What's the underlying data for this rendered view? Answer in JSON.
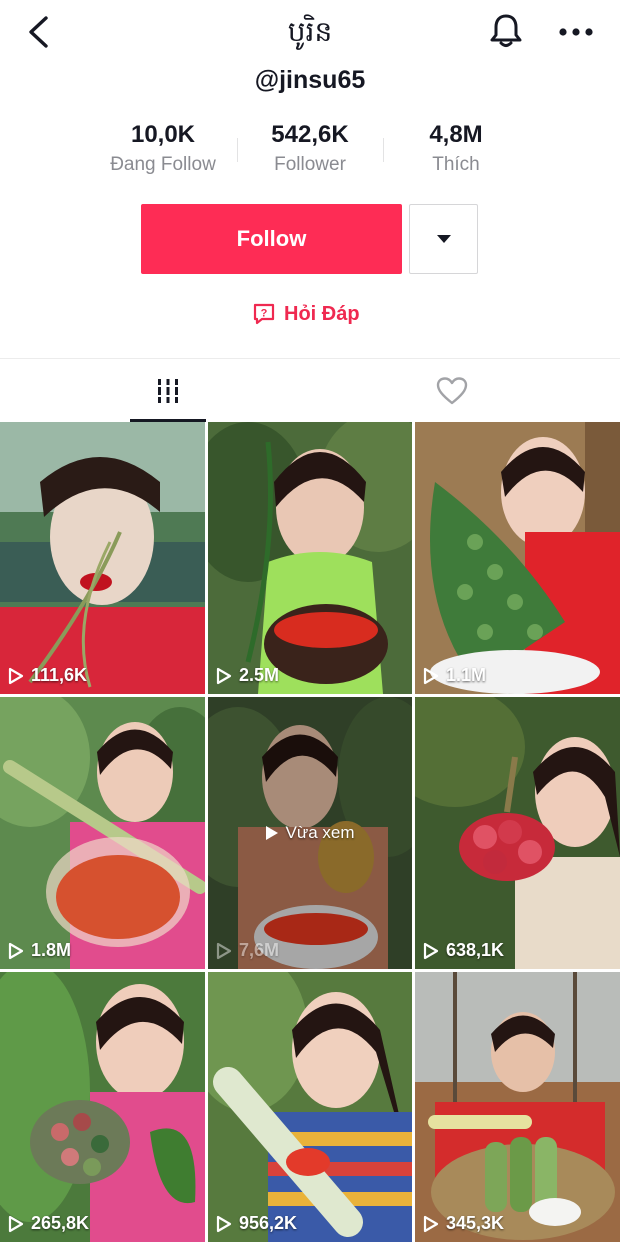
{
  "header": {
    "title": "បូរិន",
    "handle": "@jinsu65"
  },
  "stats": [
    {
      "value": "10,0K",
      "label": "Đang Follow"
    },
    {
      "value": "542,6K",
      "label": "Follower"
    },
    {
      "value": "4,8M",
      "label": "Thích"
    }
  ],
  "actions": {
    "follow_label": "Follow",
    "qa_label": "Hỏi Đáp"
  },
  "colors": {
    "accent": "#fe2c55",
    "text": "#161823",
    "muted": "#8a8b91"
  },
  "videos": [
    {
      "views": "111,6K"
    },
    {
      "views": "2.5M"
    },
    {
      "views": "1.1M"
    },
    {
      "views": "1.8M"
    },
    {
      "views": "7,6M",
      "overlay": "Vừa xem"
    },
    {
      "views": "638,1K"
    },
    {
      "views": "265,8K"
    },
    {
      "views": "956,2K"
    },
    {
      "views": "345,3K"
    }
  ]
}
